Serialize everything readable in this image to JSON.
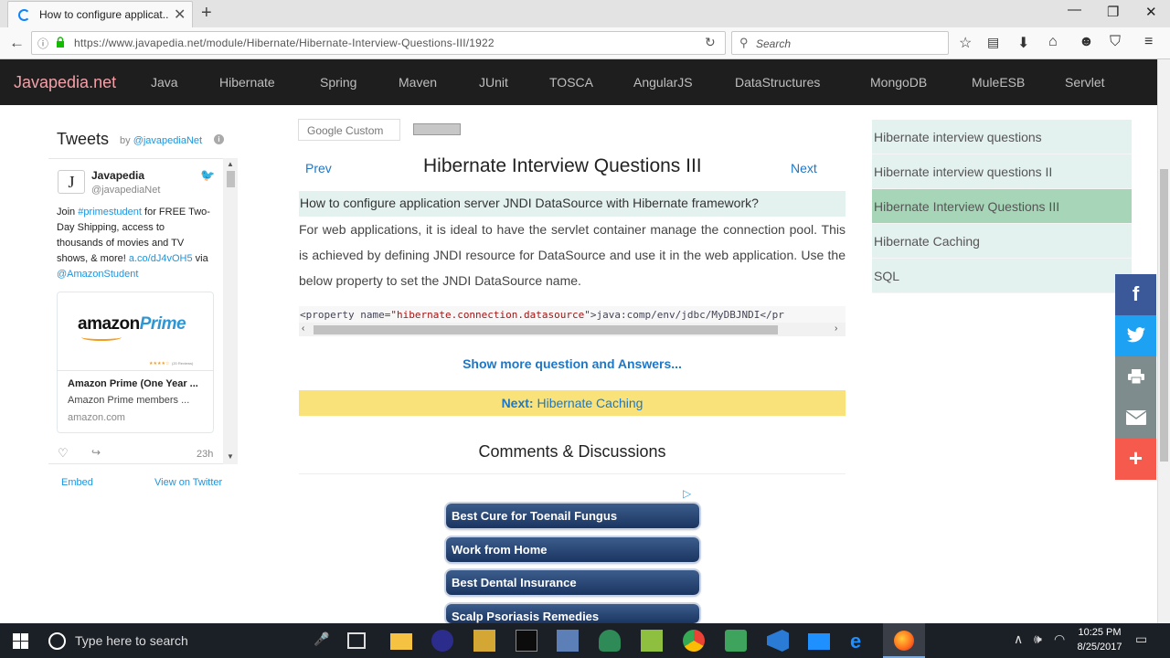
{
  "browser": {
    "tab_title": "How to configure applicat...",
    "tab_close": "✕",
    "new_tab": "+",
    "url": "https://www.javapedia.net/module/Hibernate/Hibernate-Interview-Questions-III/1922",
    "search_placeholder": "Search"
  },
  "site": {
    "brand": "Javapedia.net",
    "nav": [
      "Java",
      "Hibernate",
      "Spring",
      "Maven",
      "JUnit",
      "TOSCA",
      "AngularJS",
      "DataStructures",
      "MongoDB",
      "MuleESB",
      "Servlet"
    ]
  },
  "twitter": {
    "title": "Tweets",
    "by": "by",
    "account": "@javapediaNet",
    "info": "i",
    "tweet": {
      "name": "Javapedia",
      "handle": "@javapediaNet",
      "text_1": "Join ",
      "hashtag": "#primestudent",
      "text_2": " for FREE Two-Day Shipping, access to thousands of movies and TV shows, & more! ",
      "link": "a.co/dJ4vOH5",
      "text_3": " via ",
      "mention": "@AmazonStudent",
      "time": "23h"
    },
    "card": {
      "logo_amazon": "amazon",
      "logo_prime": "Prime",
      "stars": "★★★★☆",
      "reviews": "(20 Reviews)",
      "title": "Amazon Prime (One Year ...",
      "desc": "Amazon Prime members ...",
      "domain": "amazon.com"
    },
    "embed": "Embed",
    "view": "View on Twitter"
  },
  "search_widget": {
    "placeholder": "Google Custom"
  },
  "article": {
    "prev": "Prev",
    "title": "Hibernate Interview Questions III",
    "next": "Next",
    "question": "How to configure application server JNDI DataSource with Hibernate framework?",
    "answer": "For web applications, it is ideal to have the servlet container manage the connection pool. This is achieved by defining JNDI resource for DataSource and use it in the web application. Use the below property to set the JNDI DataSource name.",
    "code_open": "<property name=",
    "code_attr": "\"hibernate.connection.datasource\"",
    "code_rest": ">java:comp/env/jdbc/MyDBJNDI</pr",
    "show_more": "Show more question and Answers...",
    "next_label": "Next:",
    "next_target": "Hibernate Caching",
    "comments_title": "Comments & Discussions"
  },
  "ads": [
    "Best Cure for Toenail Fungus",
    "Work from Home",
    "Best Dental Insurance",
    "Scalp Psoriasis Remedies"
  ],
  "sidebar": {
    "items": [
      "Hibernate interview questions",
      "Hibernate interview questions II",
      "Hibernate Interview Questions III",
      "Hibernate Caching",
      "SQL"
    ],
    "active_index": 2
  },
  "share": {
    "facebook": "f",
    "more": "+"
  },
  "taskbar": {
    "search_placeholder": "Type here to search",
    "time": "10:25 PM",
    "date": "8/25/2017"
  },
  "colors": {
    "nav_bg": "#1e1e1e",
    "brand": "#f4a0a8",
    "link": "#1e77c6",
    "question_bg": "#e3f1ef",
    "active_side": "#a6d5b7",
    "next_banner": "#f9e27a"
  }
}
